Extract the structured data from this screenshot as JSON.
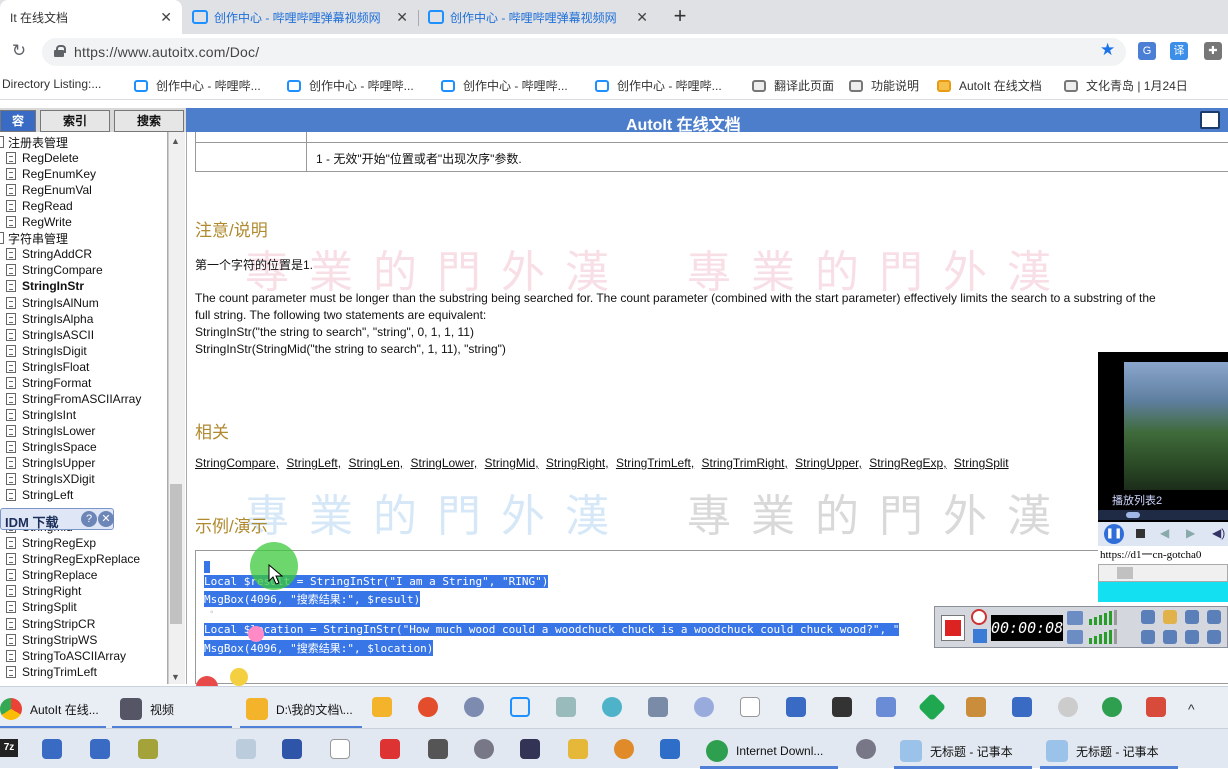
{
  "browser": {
    "tabs": [
      {
        "title": "It 在线文档",
        "close": "✕"
      },
      {
        "title": "创作中心 - 哔哩哔哩弹幕视频网",
        "close": "✕"
      },
      {
        "title": "创作中心 - 哔哩哔哩弹幕视频网",
        "close": "✕"
      }
    ],
    "new_tab": "+",
    "url": "https://www.autoitx.com/Doc/",
    "bookmarks": [
      "Directory Listing:...",
      "创作中心 - 哔哩哔...",
      "创作中心 - 哔哩哔...",
      "创作中心 - 哔哩哔...",
      "创作中心 - 哔哩哔...",
      "翻译此页面",
      "功能说明",
      "AutoIt 在线文档",
      "文化青岛 | 1月24日"
    ],
    "ext_label": "译"
  },
  "help": {
    "tabs": [
      "容",
      "索引",
      "搜索"
    ],
    "title": "AutoIt 在线文档",
    "tree": [
      {
        "label": "注册表管理",
        "kind": "folder"
      },
      {
        "label": "RegDelete",
        "kind": "page"
      },
      {
        "label": "RegEnumKey",
        "kind": "page"
      },
      {
        "label": "RegEnumVal",
        "kind": "page"
      },
      {
        "label": "RegRead",
        "kind": "page"
      },
      {
        "label": "RegWrite",
        "kind": "page"
      },
      {
        "label": "字符串管理",
        "kind": "folder"
      },
      {
        "label": "StringAddCR",
        "kind": "page"
      },
      {
        "label": "StringCompare",
        "kind": "page"
      },
      {
        "label": "StringInStr",
        "kind": "page",
        "selected": true
      },
      {
        "label": "StringIsAlNum",
        "kind": "page"
      },
      {
        "label": "StringIsAlpha",
        "kind": "page"
      },
      {
        "label": "StringIsASCII",
        "kind": "page"
      },
      {
        "label": "StringIsDigit",
        "kind": "page"
      },
      {
        "label": "StringIsFloat",
        "kind": "page"
      },
      {
        "label": "StringFormat",
        "kind": "page"
      },
      {
        "label": "StringFromASCIIArray",
        "kind": "page"
      },
      {
        "label": "StringIsInt",
        "kind": "page"
      },
      {
        "label": "StringIsLower",
        "kind": "page"
      },
      {
        "label": "StringIsSpace",
        "kind": "page"
      },
      {
        "label": "StringIsUpper",
        "kind": "page"
      },
      {
        "label": "StringIsXDigit",
        "kind": "page"
      },
      {
        "label": "StringLeft",
        "kind": "page"
      },
      {
        "label": "",
        "kind": "hidden"
      },
      {
        "label": "StringMid",
        "kind": "page"
      },
      {
        "label": "StringRegExp",
        "kind": "page"
      },
      {
        "label": "StringRegExpReplace",
        "kind": "page"
      },
      {
        "label": "StringReplace",
        "kind": "page"
      },
      {
        "label": "StringRight",
        "kind": "page"
      },
      {
        "label": "StringSplit",
        "kind": "page"
      },
      {
        "label": "StringStripCR",
        "kind": "page"
      },
      {
        "label": "StringStripWS",
        "kind": "page"
      },
      {
        "label": "StringToASCIIArray",
        "kind": "page"
      },
      {
        "label": "StringTrimLeft",
        "kind": "page"
      }
    ],
    "idm_label": "IDM 下载",
    "idm_help": "?",
    "idm_close": "✕"
  },
  "content": {
    "table_row": "1 - 无效\"开始\"位置或者\"出现次序\"参数.",
    "notes_heading": "注意/说明",
    "note1": "第一个字符的位置是1.",
    "note2": "The count parameter must be longer than the substring being searched for. The count parameter (combined with the start parameter) effectively limits the search to a substring of the",
    "note3": "full string. The following two statements are equivalent:",
    "note4": "StringInStr(\"the string to search\", \"string\", 0, 1, 1, 11)",
    "note5": "StringInStr(StringMid(\"the string to search\", 1, 11), \"string\")",
    "related_heading": "相关",
    "related_links": [
      "StringCompare,",
      "StringLeft,",
      "StringLen,",
      "StringLower,",
      "StringMid,",
      "StringRight,",
      "StringTrimLeft,",
      "StringTrimRight,",
      "StringUpper,",
      "StringRegExp,",
      "StringSplit"
    ],
    "example_heading": "示例/演示",
    "code": [
      "Local $result = StringInStr(\"I am a String\", \"RING\")",
      "MsgBox(4096, \"搜索结果:\", $result)",
      "Local $location = StringInStr(\"How much wood could a woodchuck chuck is a woodchuck could chuck wood?\", \"",
      "MsgBox(4096, \"搜索结果:\", $location)"
    ],
    "watermark_text": "專業的門外漢"
  },
  "player": {
    "playlist_label": "播放列表2",
    "url_text": "https://d1一cn-gotcha0"
  },
  "recorder": {
    "time": "00:00:08"
  },
  "taskbar": {
    "row1": [
      "AutoIt 在线...",
      "视频",
      "D:\\我的文档\\..."
    ],
    "row2": [
      "Internet Downl...",
      "无标题 - 记事本",
      "无标题 - 记事本"
    ],
    "start_label": "7z",
    "chevron": "^"
  },
  "colors": {
    "help_bar": "#4d7ecb",
    "section_heading": "#b08a2e",
    "code_highlight": "#3876e8"
  }
}
